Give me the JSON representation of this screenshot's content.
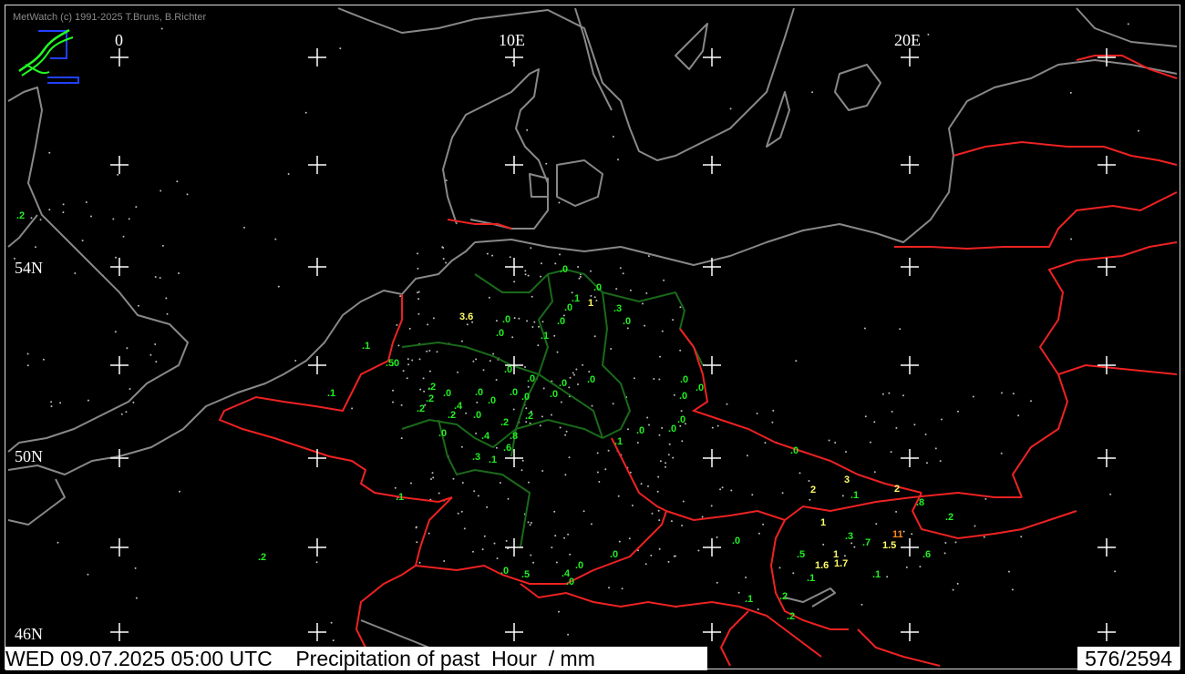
{
  "header": {
    "copyright": "MetWatch  (c) 1991-2025 T.Bruns, B.Richter"
  },
  "axes": {
    "longitudes": [
      "0",
      "10E",
      "20E"
    ],
    "latitudes": [
      "54N",
      "50N",
      "46N"
    ]
  },
  "footer": {
    "datetime": "WED 09.07.2025 05:00 UTC",
    "title": "Precipitation of past  Hour  / mm",
    "counter": "576/2594"
  },
  "colors": {
    "low": "#22ee22",
    "medium": "#ffff66",
    "high": "#ff8822",
    "border": "#ee2222",
    "state_border": "#1a6a1a",
    "coast": "#888888"
  },
  "precip_values": [
    ".2",
    ".0",
    ".0",
    ".1",
    ".5",
    "3.6",
    ".0",
    ".0",
    ".0",
    ".3",
    ".1",
    ".0",
    ".1",
    ".0",
    ".0",
    ".2",
    ".0",
    ".4",
    ".2",
    ".1",
    ".0",
    ".0",
    ".0",
    ".2",
    ".2",
    ".0",
    ".0",
    ".0",
    ".0",
    "1",
    ".0",
    ".0",
    ".2",
    ".0",
    ".4",
    ".0",
    ".2",
    ".8",
    ".6",
    ".3",
    ".1",
    ".1",
    ".0",
    ".0",
    ".0",
    ".1",
    ".0",
    ".0",
    ".0",
    "2",
    "3",
    ".1",
    "2",
    ".8",
    ".2",
    "1",
    ".3",
    ".7",
    "11",
    "1.5",
    ".6",
    ".0",
    ".0",
    ".5",
    "1",
    "1.6",
    "1.7",
    ".1",
    ".1",
    ".2",
    ".2",
    ".1",
    ".0",
    ".0",
    ".5",
    ".4",
    ".0",
    ".0",
    ".2"
  ]
}
